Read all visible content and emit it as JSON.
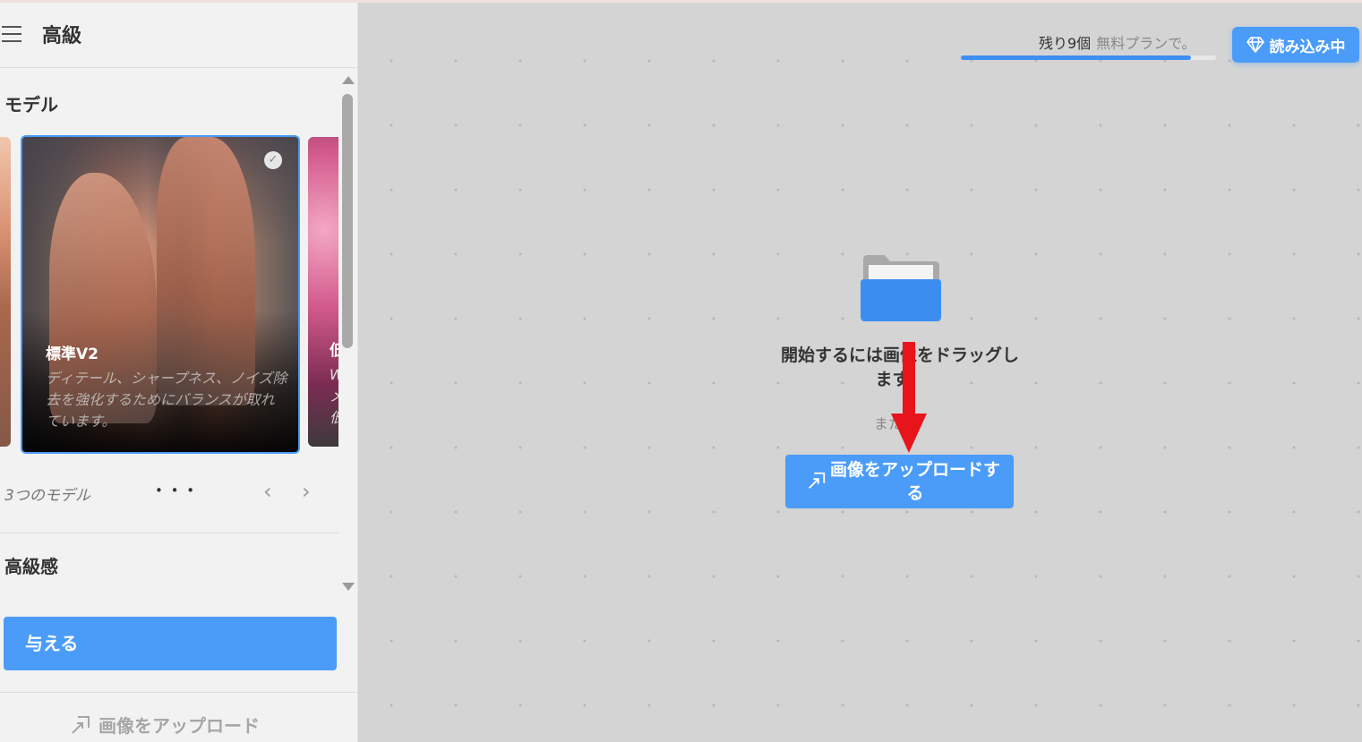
{
  "sidebar": {
    "title": "高級",
    "section_model": "モデル",
    "models": [
      {
        "name": "標準V2",
        "description": "ディテール、シャープネス、ノイズ除去を強化するためにバランスが取れています。",
        "selected": true
      },
      {
        "name": "低",
        "description": "W\nメ\n低",
        "selected": false
      }
    ],
    "model_count": "3つのモデル",
    "pagination_dots": "• • •",
    "prev_arrow": "‹",
    "next_arrow": "›",
    "section_quality": "高級感",
    "give_button": "与える",
    "upload_link": "画像をアップロード"
  },
  "canvas": {
    "quota_remaining": "残り9個",
    "quota_plan": "無料プランで。",
    "quota_progress": 0.9,
    "load_button": "読み込み中",
    "drop_text": "開始するには画像をドラッグします。",
    "or_text": "または",
    "upload_button": "画像をアップロードする"
  },
  "colors": {
    "accent": "#4b9cf9",
    "annotation_arrow": "#e8141c"
  }
}
